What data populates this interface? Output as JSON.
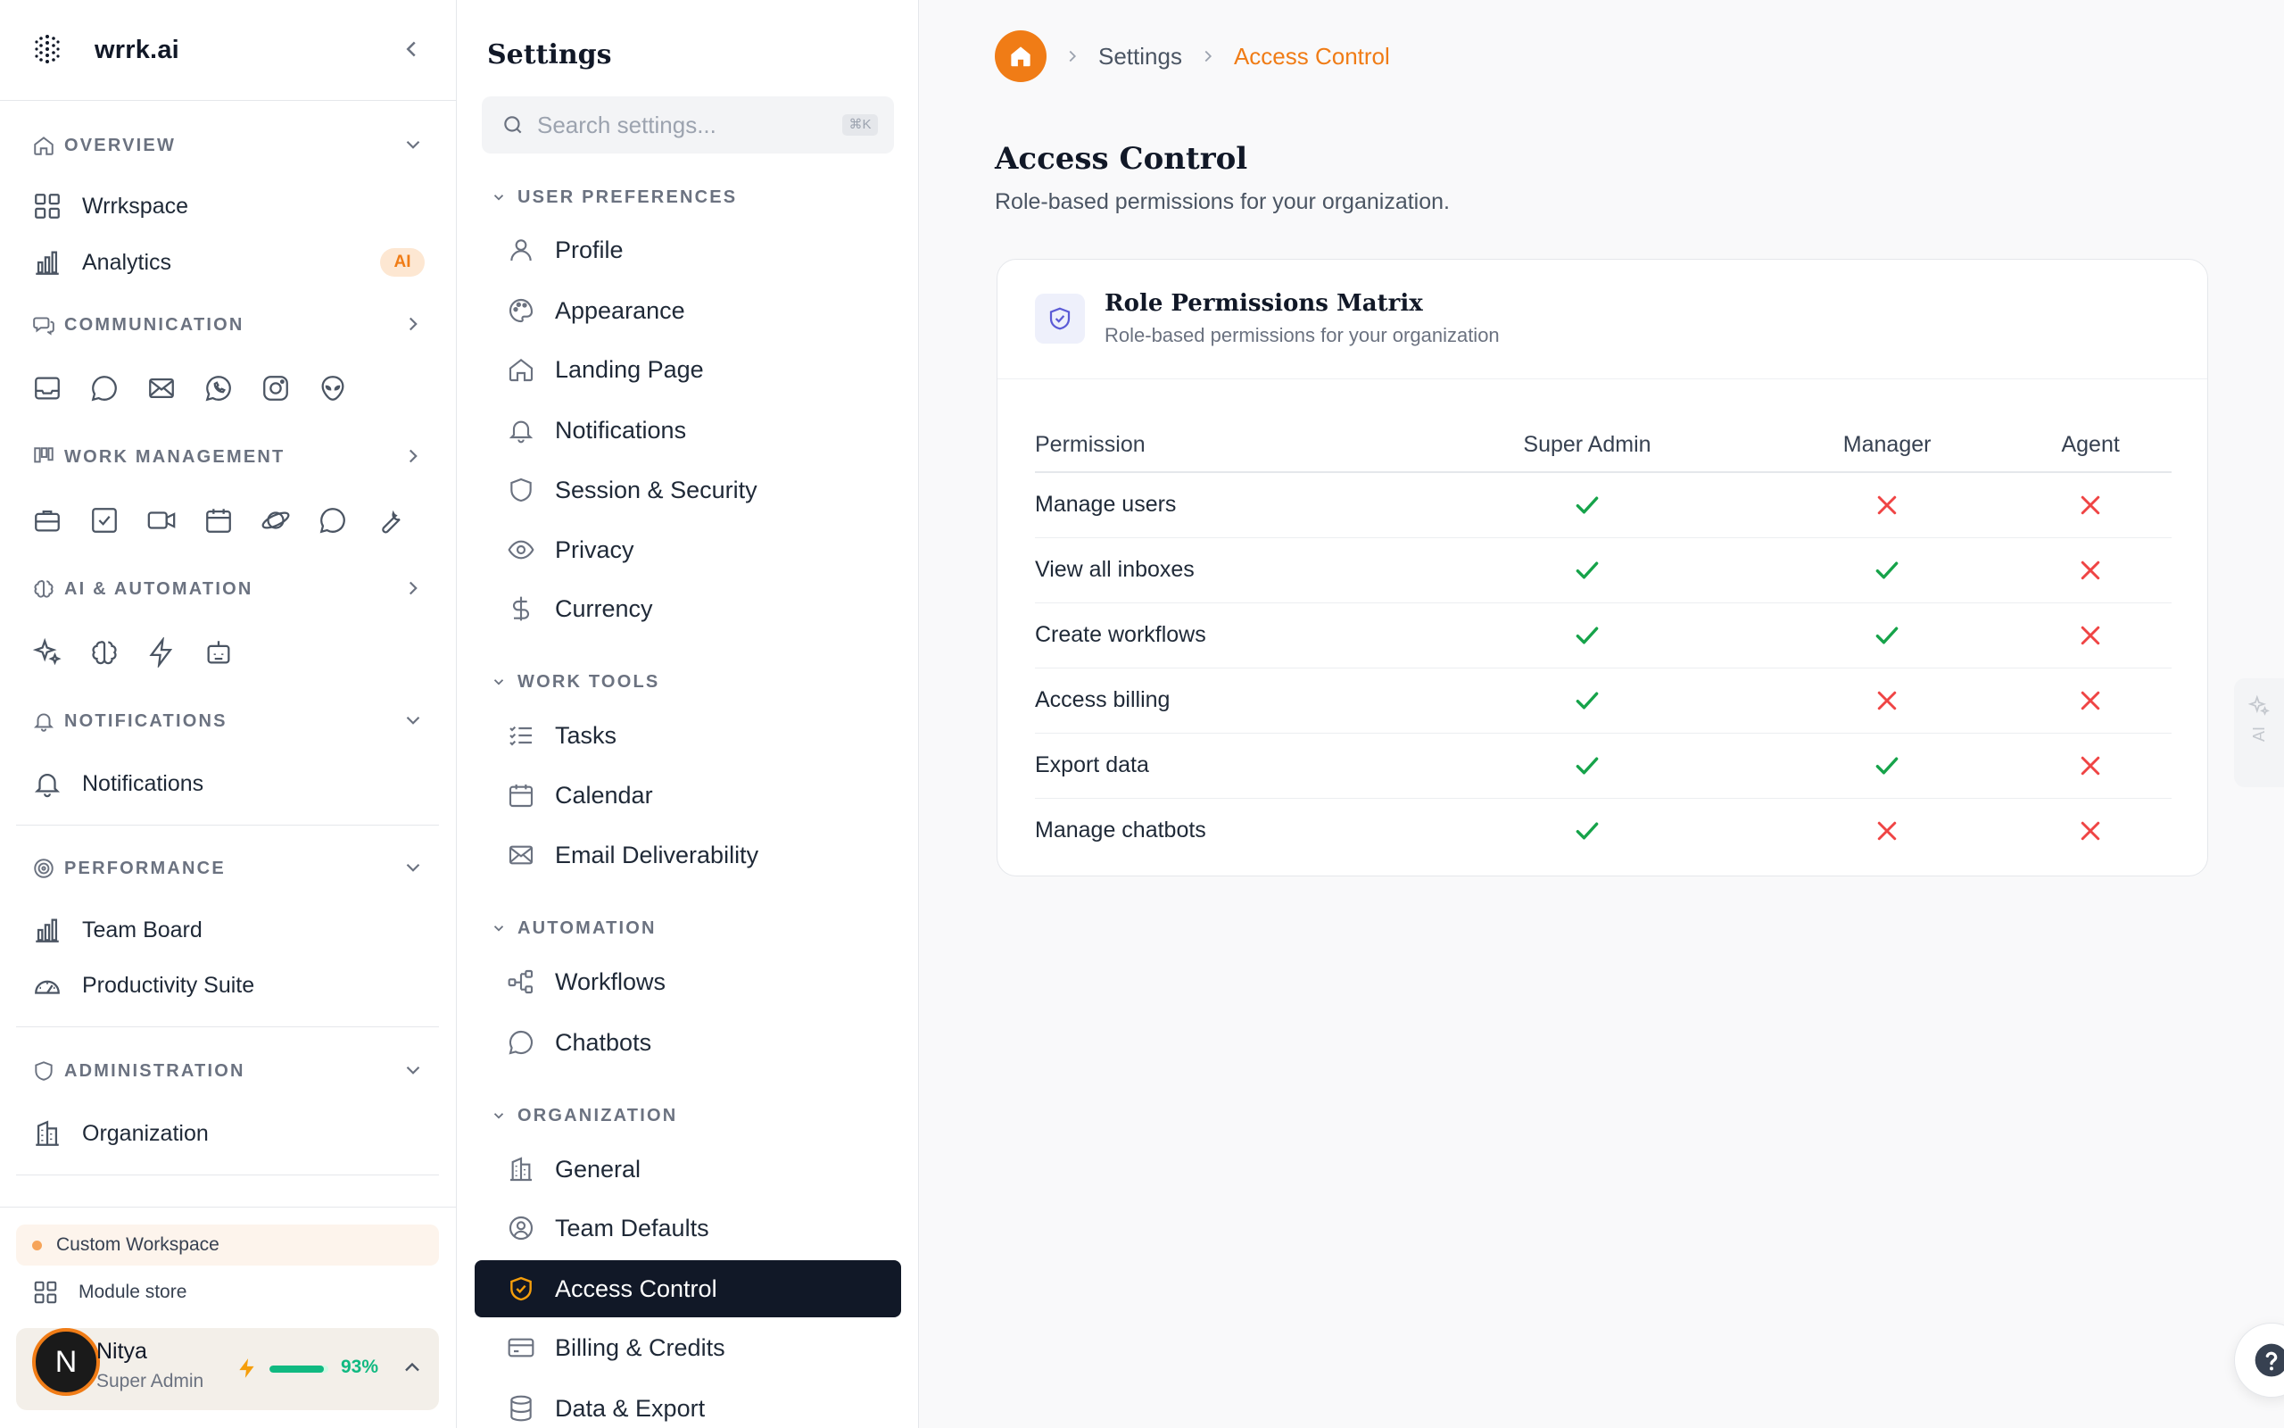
{
  "brand": {
    "name": "wrrk.ai"
  },
  "nav": {
    "overview": {
      "label": "OVERVIEW",
      "items": [
        {
          "label": "Wrrkspace"
        },
        {
          "label": "Analytics",
          "badge": "AI"
        }
      ]
    },
    "communication": {
      "label": "COMMUNICATION",
      "icons": [
        "inbox-icon",
        "chat-icon",
        "mail-icon",
        "whatsapp-icon",
        "instagram-icon",
        "alien-icon"
      ]
    },
    "work_management": {
      "label": "WORK MANAGEMENT",
      "icons": [
        "briefcase-icon",
        "checkbox-icon",
        "video-icon",
        "calendar-icon",
        "planet-icon",
        "comment-icon",
        "wrench-icon"
      ]
    },
    "ai_automation": {
      "label": "AI & AUTOMATION",
      "icons": [
        "sparkles-icon",
        "brain-icon",
        "bolt-icon",
        "bot-icon"
      ]
    },
    "notifications": {
      "label": "NOTIFICATIONS",
      "items": [
        {
          "label": "Notifications"
        }
      ]
    },
    "performance": {
      "label": "PERFORMANCE",
      "items": [
        {
          "label": "Team Board"
        },
        {
          "label": "Productivity Suite"
        }
      ]
    },
    "administration": {
      "label": "ADMINISTRATION",
      "items": [
        {
          "label": "Organization"
        }
      ]
    },
    "custom_workspace": "Custom Workspace",
    "module_store": "Module store"
  },
  "user": {
    "name": "Nitya",
    "initial": "N",
    "role": "Super Admin",
    "usage_percent": 93,
    "usage_text": "93%"
  },
  "settings": {
    "title": "Settings",
    "search_placeholder": "Search settings...",
    "shortcut": "⌘K",
    "groups": [
      {
        "label": "USER PREFERENCES",
        "items": [
          {
            "label": "Profile"
          },
          {
            "label": "Appearance"
          },
          {
            "label": "Landing Page"
          },
          {
            "label": "Notifications"
          },
          {
            "label": "Session & Security"
          },
          {
            "label": "Privacy"
          },
          {
            "label": "Currency"
          }
        ]
      },
      {
        "label": "WORK TOOLS",
        "items": [
          {
            "label": "Tasks"
          },
          {
            "label": "Calendar"
          },
          {
            "label": "Email Deliverability"
          }
        ]
      },
      {
        "label": "AUTOMATION",
        "items": [
          {
            "label": "Workflows"
          },
          {
            "label": "Chatbots"
          }
        ]
      },
      {
        "label": "ORGANIZATION",
        "items": [
          {
            "label": "General"
          },
          {
            "label": "Team Defaults"
          },
          {
            "label": "Access Control",
            "active": true
          },
          {
            "label": "Billing & Credits"
          },
          {
            "label": "Data & Export"
          }
        ]
      }
    ]
  },
  "breadcrumb": {
    "items": [
      "Settings",
      "Access Control"
    ]
  },
  "page": {
    "title": "Access Control",
    "subtitle": "Role-based permissions for your organization."
  },
  "matrix": {
    "title": "Role Permissions Matrix",
    "subtitle": "Role-based permissions for your organization",
    "columns": [
      "Permission",
      "Super Admin",
      "Manager",
      "Agent"
    ],
    "rows": [
      {
        "permission": "Manage users",
        "values": [
          true,
          false,
          false
        ]
      },
      {
        "permission": "View all inboxes",
        "values": [
          true,
          true,
          false
        ]
      },
      {
        "permission": "Create workflows",
        "values": [
          true,
          true,
          false
        ]
      },
      {
        "permission": "Access billing",
        "values": [
          true,
          false,
          false
        ]
      },
      {
        "permission": "Export data",
        "values": [
          true,
          true,
          false
        ]
      },
      {
        "permission": "Manage chatbots",
        "values": [
          true,
          false,
          false
        ]
      }
    ]
  },
  "side_tab": {
    "label": "AI"
  },
  "colors": {
    "accent": "#f07c16",
    "success": "#16a34a",
    "danger": "#ef4444",
    "active_bg": "#111827"
  }
}
